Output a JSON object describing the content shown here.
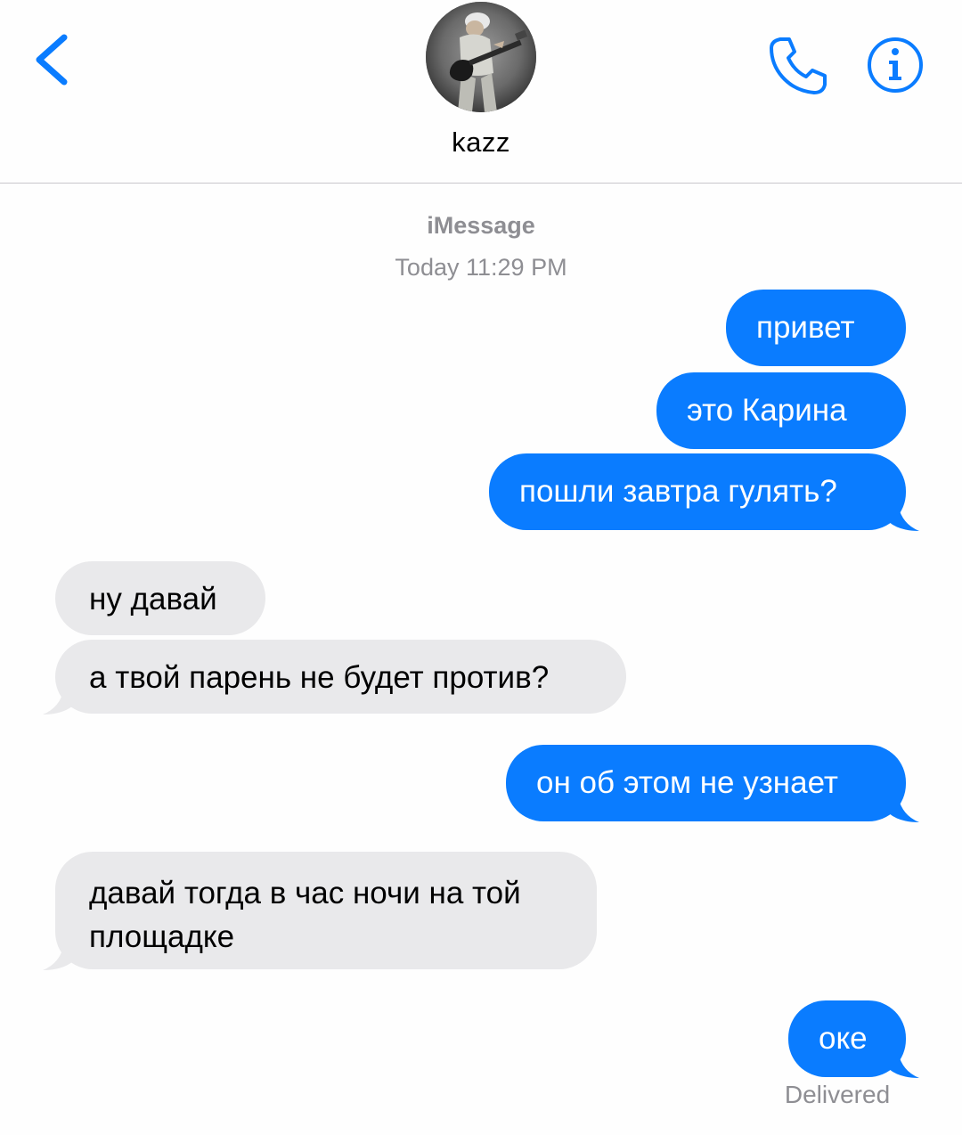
{
  "header": {
    "contact_name": "kazz",
    "back_icon": "chevron-left-icon",
    "phone_icon": "phone-icon",
    "info_icon": "info-icon",
    "accent_color": "#0a7cff"
  },
  "thread": {
    "service_label": "iMessage",
    "timestamp_day": "Today",
    "timestamp_time": "11:29 PM",
    "delivered_label": "Delivered"
  },
  "messages": [
    {
      "direction": "sent",
      "text": "привет"
    },
    {
      "direction": "sent",
      "text": "это Карина"
    },
    {
      "direction": "sent",
      "text": "пошли завтра гулять?"
    },
    {
      "direction": "received",
      "text": "ну давай"
    },
    {
      "direction": "received",
      "text": "а твой парень не будет против?"
    },
    {
      "direction": "sent",
      "text": "он об этом не узнает"
    },
    {
      "direction": "received",
      "text": "давай тогда в час ночи на той площадке"
    },
    {
      "direction": "sent",
      "text": "оке"
    }
  ],
  "colors": {
    "sent_bubble": "#0a7cff",
    "received_bubble": "#e9e9eb",
    "meta_text": "#8e8e93"
  }
}
